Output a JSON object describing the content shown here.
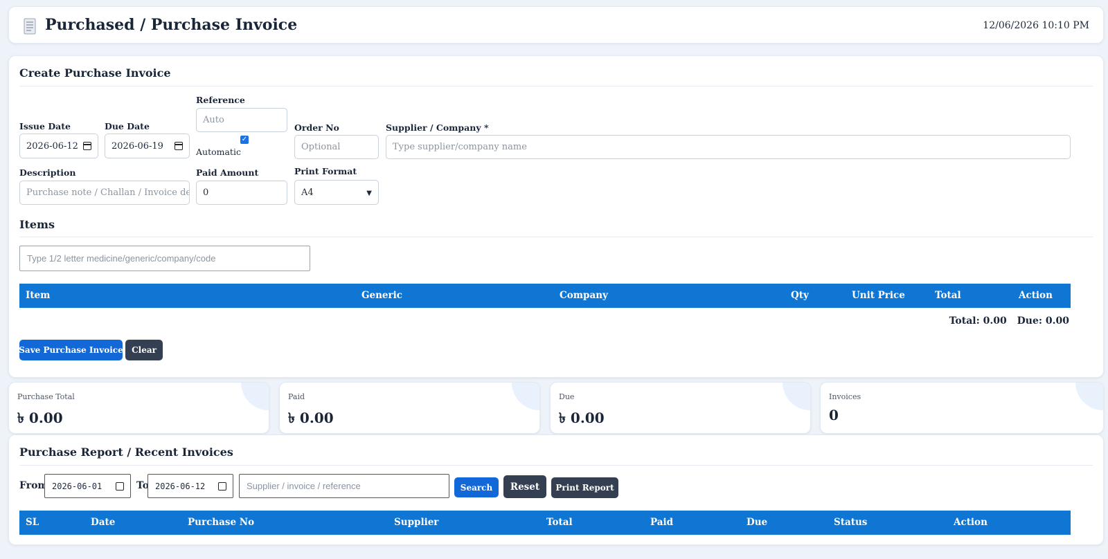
{
  "header": {
    "icon": "document-icon",
    "title": "Purchased / Purchase Invoice",
    "datetime": "12/06/2026 10:10 PM"
  },
  "create": {
    "title": "Create Purchase Invoice",
    "issue_date": {
      "label": "Issue Date",
      "value": "2026-06-12"
    },
    "due_date": {
      "label": "Due Date",
      "value": "2026-06-19"
    },
    "reference": {
      "label": "Reference",
      "placeholder": "Auto",
      "checkbox_label": "Automatic",
      "checked": true
    },
    "order_no": {
      "label": "Order No",
      "placeholder": "Optional"
    },
    "supplier": {
      "label": "Supplier / Company *",
      "placeholder": "Type supplier/company name"
    },
    "description": {
      "label": "Description",
      "placeholder": "Purchase note / Challan / Invoice detai"
    },
    "paid_amount": {
      "label": "Paid Amount",
      "value": "0"
    },
    "print_format": {
      "label": "Print Format",
      "value": "A4"
    },
    "items_title": "Items",
    "item_search_placeholder": "Type 1/2 letter medicine/generic/company/code",
    "columns": [
      "Item",
      "Generic",
      "Company",
      "Qty",
      "Unit Price",
      "Total",
      "Action"
    ],
    "total_text": "Total: 0.00",
    "due_text": "Due: 0.00",
    "save_button": "Save Purchase Invoice",
    "clear_button": "Clear"
  },
  "stats": [
    {
      "label": "Purchase Total",
      "value": "৳ 0.00"
    },
    {
      "label": "Paid",
      "value": "৳ 0.00"
    },
    {
      "label": "Due",
      "value": "৳ 0.00"
    },
    {
      "label": "Invoices",
      "value": "0"
    }
  ],
  "report": {
    "title": "Purchase Report / Recent Invoices",
    "from_label": "From",
    "from_value": "2026-06-01",
    "to_label": "To",
    "to_value": "2026-06-12",
    "search_placeholder": "Supplier / invoice / reference",
    "search_button": "Search",
    "reset_button": "Reset",
    "print_button": "Print Report",
    "columns": [
      "SL",
      "Date",
      "Purchase No",
      "Supplier",
      "Total",
      "Paid",
      "Due",
      "Status",
      "Action"
    ]
  },
  "colors": {
    "primary": "#0f76d4",
    "dark_button": "#343f51",
    "background": "#eef3f9"
  }
}
